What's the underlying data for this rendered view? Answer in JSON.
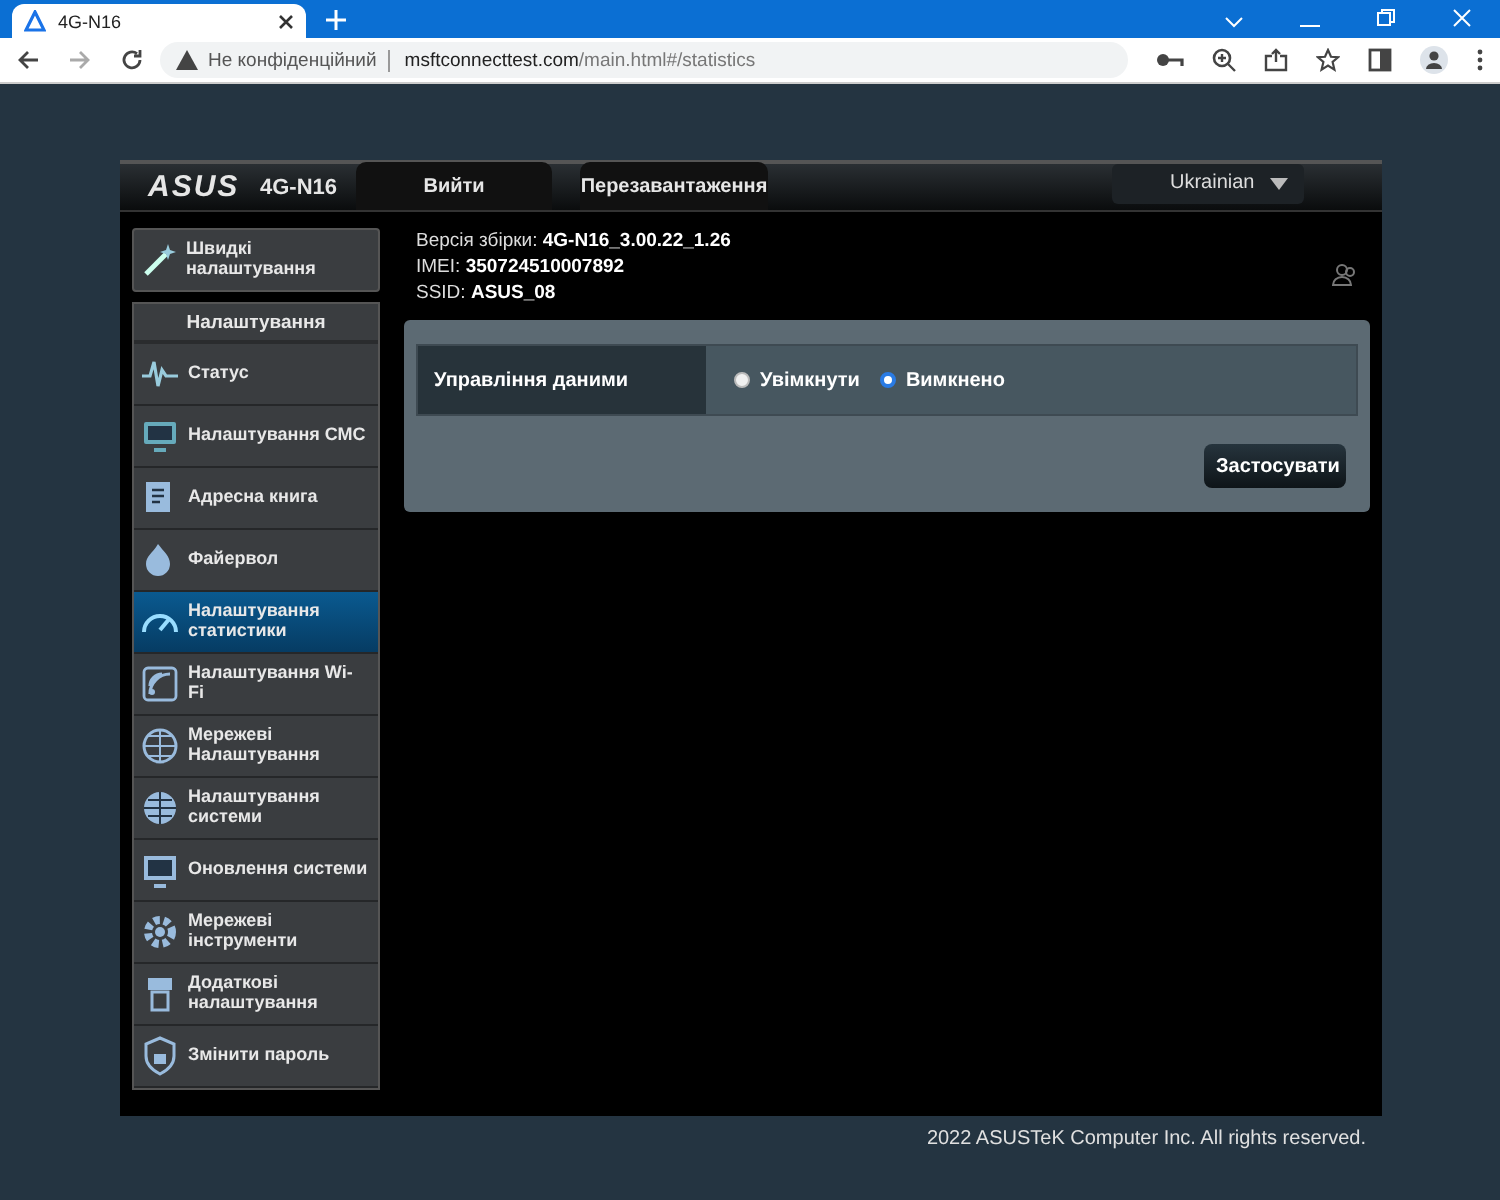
{
  "browser": {
    "tab_title": "4G-N16",
    "security": "Не конфіденційний",
    "url_host": "msftconnecttest.com",
    "url_path": "/main.html#/statistics"
  },
  "header": {
    "logo": "ASUS",
    "model": "4G-N16",
    "buttons": [
      "Вийти",
      "Перезавантаження"
    ],
    "language": "Ukrainian"
  },
  "info": [
    {
      "label": "Версія збірки:",
      "value": "4G-N16_3.00.22_1.26"
    },
    {
      "label": "IMEI:",
      "value": "350724510007892"
    },
    {
      "label": "SSID:",
      "value": "ASUS_08"
    }
  ],
  "quick_setup": {
    "label": "Швидкі налаштування"
  },
  "sidebar": {
    "title": "Налаштування",
    "items": [
      {
        "label": "Статус",
        "selected": false
      },
      {
        "label": "Налаштування СМС",
        "selected": false
      },
      {
        "label": "Адресна книга",
        "selected": false
      },
      {
        "label": "Файервол",
        "selected": false
      },
      {
        "label": "Налаштування статистики",
        "selected": true
      },
      {
        "label": "Налаштування Wi-Fi",
        "selected": false
      },
      {
        "label": "Мережеві Налаштування",
        "selected": false
      },
      {
        "label": "Налаштування системи",
        "selected": false
      },
      {
        "label": "Оновлення системи",
        "selected": false
      },
      {
        "label": "Мережеві інструменти",
        "selected": false
      },
      {
        "label": "Додаткові налаштування",
        "selected": false
      },
      {
        "label": "Змінити пароль",
        "selected": false
      }
    ]
  },
  "setting": {
    "label": "Управління даними",
    "options": [
      {
        "label": "Увімкнути",
        "selected": false
      },
      {
        "label": "Вимкнено",
        "selected": true
      }
    ]
  },
  "apply_button": "Застосувати",
  "footer": "2022 ASUSTeK Computer Inc. All rights reserved."
}
